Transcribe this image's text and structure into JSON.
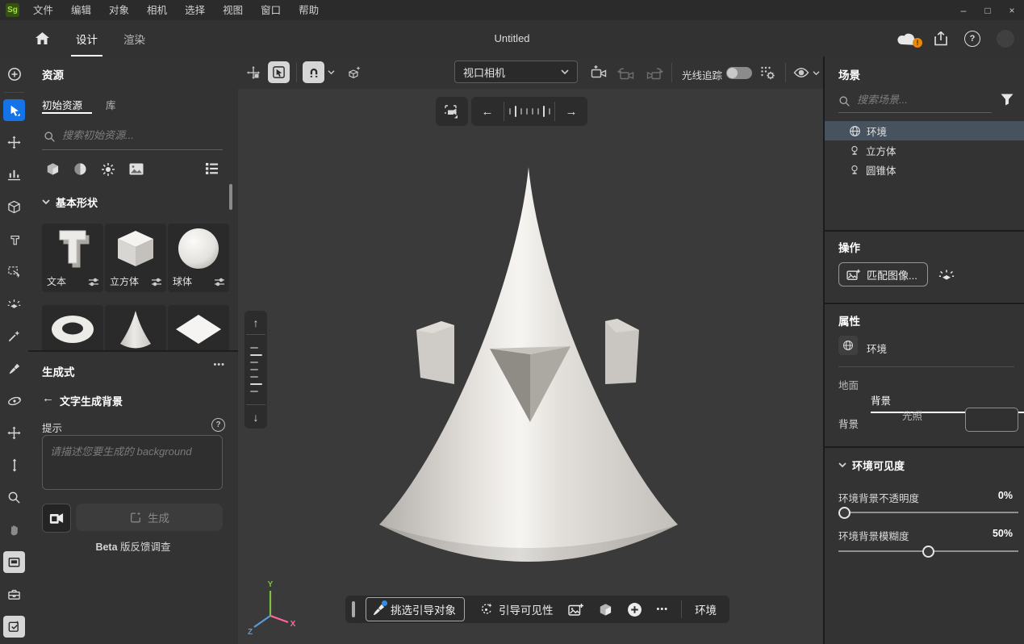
{
  "window": {
    "logo": "Sg",
    "menu": [
      "文件",
      "编辑",
      "对象",
      "相机",
      "选择",
      "视图",
      "窗口",
      "帮助"
    ],
    "controls": {
      "minimize": "–",
      "maximize": "□",
      "close": "×"
    }
  },
  "header": {
    "tab_design": "设计",
    "tab_render": "渲染",
    "title": "Untitled"
  },
  "glyphs": {
    "question": "?"
  },
  "assets": {
    "title": "资源",
    "tab_starter": "初始资源",
    "tab_library": "库",
    "search_placeholder": "搜索初始资源...",
    "section_title": "基本形状",
    "shapes": [
      {
        "label": "文本"
      },
      {
        "label": "立方体"
      },
      {
        "label": "球体"
      }
    ]
  },
  "generative": {
    "title": "生成式",
    "more": "•••",
    "back_arrow": "←",
    "back_label": "文字生成背景",
    "prompt_label": "提示",
    "prompt_placeholder": "请描述您要生成的 background",
    "generate_label": "生成",
    "beta_bold": "Beta",
    "beta_rest": " 版反馈调查"
  },
  "viewport": {
    "camera_select": "视口相机",
    "raytrace_label": "光线追踪",
    "nav": {
      "left": "←",
      "right": "→",
      "up": "↑",
      "down": "↓"
    },
    "bottom_bar": {
      "pick_label": "挑选引导对象",
      "visibility_label": "引导可见性",
      "more": "•••",
      "env_label": "环境"
    },
    "axis": {
      "x": "X",
      "y": "Y",
      "z": "Z"
    }
  },
  "scene": {
    "title": "场景",
    "search_placeholder": "搜索场景...",
    "items": [
      {
        "label": "环境"
      },
      {
        "label": "立方体"
      },
      {
        "label": "圆锥体"
      }
    ]
  },
  "actions": {
    "title": "操作",
    "match_image_label": "匹配图像..."
  },
  "properties": {
    "title": "属性",
    "object_label": "环境",
    "tab_ground": "地面",
    "tab_background": "背景",
    "tab_light": "光照",
    "background_label": "背景",
    "env_visibility_title": "环境可见度",
    "sliders": [
      {
        "label": "环境背景不透明度",
        "value": "0%"
      },
      {
        "label": "环境背景模糊度",
        "value": "50%"
      }
    ]
  },
  "colors": {
    "accent": "#1473e6",
    "selection": "#46525e",
    "warning_badge": "#e8890c",
    "axis_x": "#ff6699",
    "axis_y": "#7ec142",
    "axis_z": "#5b9bd5"
  }
}
